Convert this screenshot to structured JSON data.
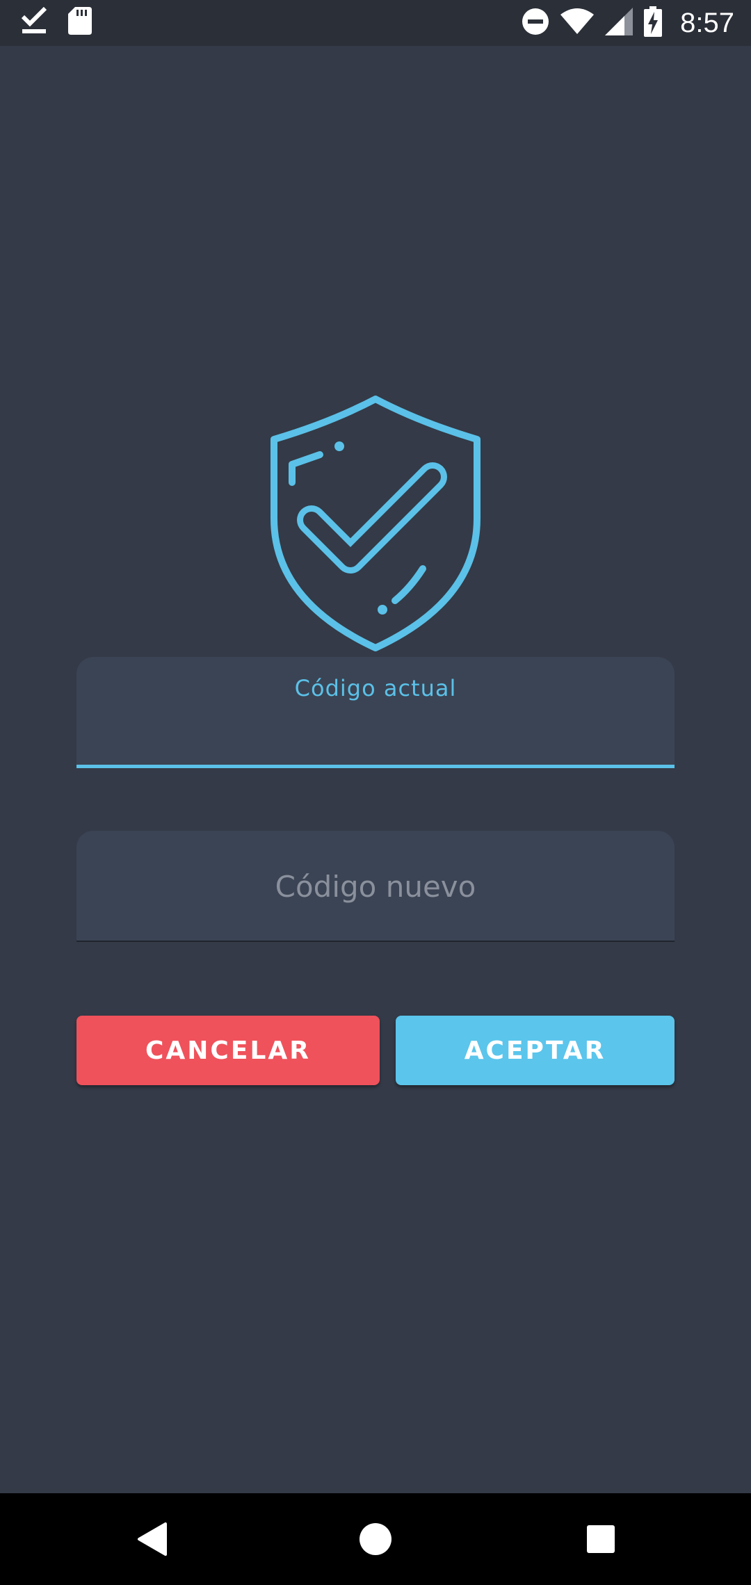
{
  "status_bar": {
    "time": "8:57",
    "icons": [
      "download-done-icon",
      "sd-card-icon",
      "do-not-disturb-icon",
      "wifi-icon",
      "cell-signal-icon",
      "battery-charging-icon"
    ]
  },
  "shield": {
    "icon": "shield-check-icon",
    "color": "#5bc1e8"
  },
  "form": {
    "current_code": {
      "label": "Código actual",
      "value": "",
      "placeholder": ""
    },
    "new_code": {
      "placeholder": "Código nuevo",
      "value": ""
    }
  },
  "buttons": {
    "cancel_label": "CANCELAR",
    "accept_label": "ACEPTAR"
  },
  "nav_bar": {
    "icons": [
      "back-icon",
      "home-icon",
      "recents-icon"
    ]
  },
  "colors": {
    "background": "#343a47",
    "accent": "#5bc1e8",
    "cancel": "#ef525b",
    "accept": "#5bc5ec"
  }
}
